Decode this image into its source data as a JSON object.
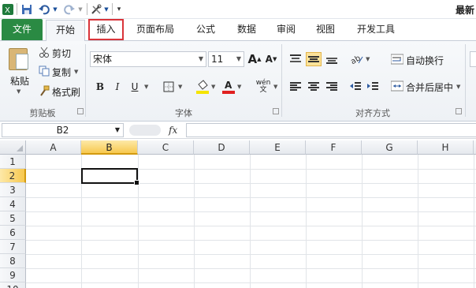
{
  "qat": {
    "title": "最新"
  },
  "tabs": [
    {
      "label": "文件"
    },
    {
      "label": "开始"
    },
    {
      "label": "插入"
    },
    {
      "label": "页面布局"
    },
    {
      "label": "公式"
    },
    {
      "label": "数据"
    },
    {
      "label": "审阅"
    },
    {
      "label": "视图"
    },
    {
      "label": "开发工具"
    }
  ],
  "clipboard": {
    "paste": "粘贴",
    "cut": "剪切",
    "copy": "复制",
    "format_painter": "格式刷",
    "group": "剪贴板"
  },
  "font": {
    "name": "宋体",
    "size": "11",
    "group": "字体",
    "bold": "B",
    "italic": "I",
    "underline": "U",
    "grow": "A",
    "shrink": "A",
    "wen": "wén"
  },
  "alignment": {
    "wrap_text": "自动换行",
    "merge_center": "合并后居中",
    "group": "对齐方式"
  },
  "formula_bar": {
    "name_box": "B2",
    "fx": "fx"
  },
  "sheet": {
    "columns": [
      "A",
      "B",
      "C",
      "D",
      "E",
      "F",
      "G",
      "H"
    ],
    "rows": [
      "1",
      "2",
      "3",
      "4",
      "5",
      "6",
      "7",
      "8",
      "9",
      "10"
    ],
    "selected_column": "B",
    "selected_row": "2",
    "active_cell": "B2"
  },
  "colors": {
    "file_tab": "#2a8a43",
    "highlight_box": "#d9343a",
    "selection_header": "#f7c84f"
  }
}
